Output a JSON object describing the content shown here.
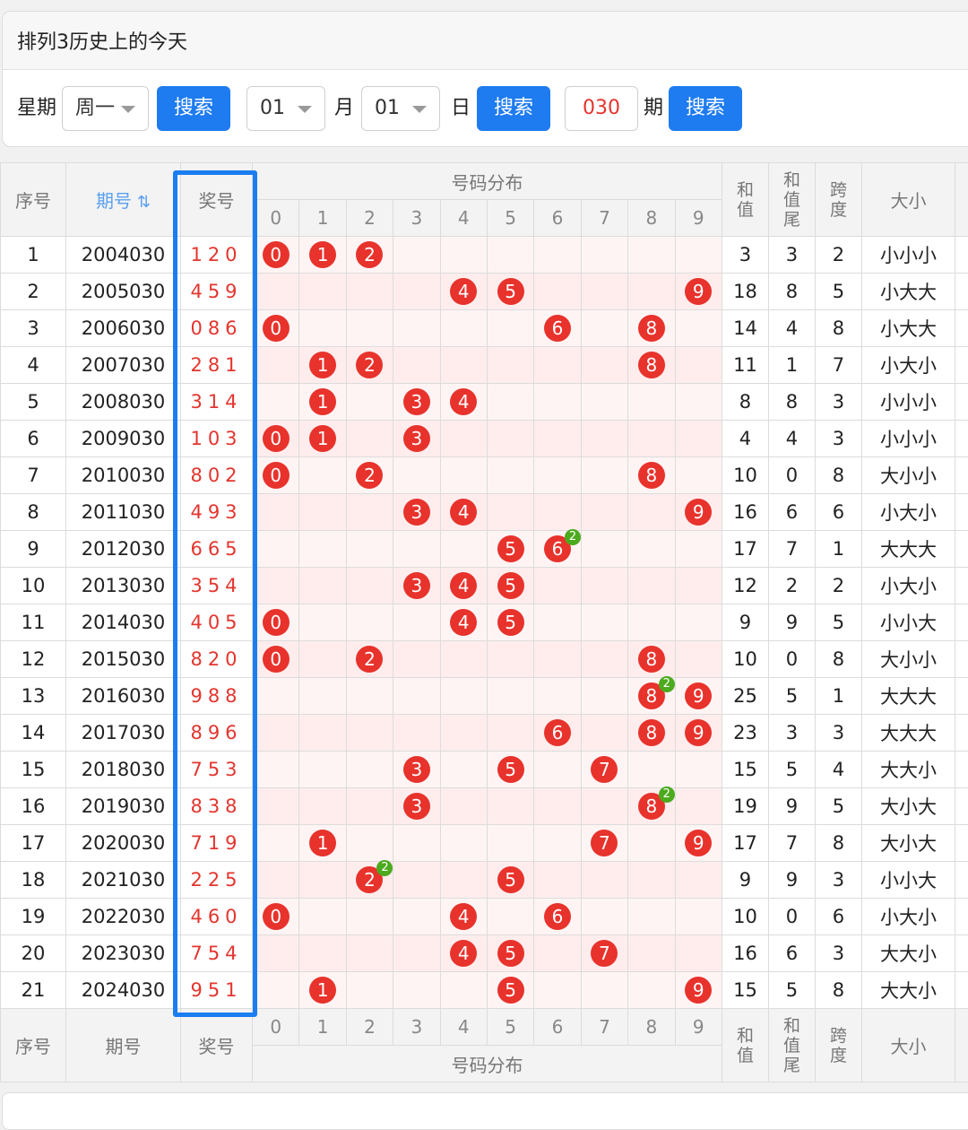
{
  "panel": {
    "title": "排列3历史上的今天"
  },
  "controls": {
    "week_label": "星期",
    "week_value": "周一",
    "search1": "搜索",
    "month_value": "01",
    "month_label": "月",
    "day_value": "01",
    "day_label": "日",
    "search2": "搜索",
    "period_value": "030",
    "period_label": "期",
    "search3": "搜索"
  },
  "table": {
    "headers": {
      "seq": "序号",
      "period": "期号",
      "prize": "奖号",
      "dist": "号码分布",
      "sum": "和值",
      "sum_tail": "和值尾",
      "span": "跨度",
      "size": "大小"
    },
    "digits": [
      "0",
      "1",
      "2",
      "3",
      "4",
      "5",
      "6",
      "7",
      "8",
      "9"
    ],
    "rows": [
      {
        "seq": "1",
        "period": "2004030",
        "prize": "120",
        "d": [
          0,
          1,
          2
        ],
        "sum": "3",
        "tail": "3",
        "span": "2",
        "size": "小小小"
      },
      {
        "seq": "2",
        "period": "2005030",
        "prize": "459",
        "d": [
          4,
          5,
          9
        ],
        "sum": "18",
        "tail": "8",
        "span": "5",
        "size": "小大大"
      },
      {
        "seq": "3",
        "period": "2006030",
        "prize": "086",
        "d": [
          0,
          6,
          8
        ],
        "sum": "14",
        "tail": "4",
        "span": "8",
        "size": "小大大"
      },
      {
        "seq": "4",
        "period": "2007030",
        "prize": "281",
        "d": [
          1,
          2,
          8
        ],
        "sum": "11",
        "tail": "1",
        "span": "7",
        "size": "小大小"
      },
      {
        "seq": "5",
        "period": "2008030",
        "prize": "314",
        "d": [
          1,
          3,
          4
        ],
        "sum": "8",
        "tail": "8",
        "span": "3",
        "size": "小小小"
      },
      {
        "seq": "6",
        "period": "2009030",
        "prize": "103",
        "d": [
          0,
          1,
          3
        ],
        "sum": "4",
        "tail": "4",
        "span": "3",
        "size": "小小小"
      },
      {
        "seq": "7",
        "period": "2010030",
        "prize": "802",
        "d": [
          0,
          2,
          8
        ],
        "sum": "10",
        "tail": "0",
        "span": "8",
        "size": "大小小"
      },
      {
        "seq": "8",
        "period": "2011030",
        "prize": "493",
        "d": [
          3,
          4,
          9
        ],
        "sum": "16",
        "tail": "6",
        "span": "6",
        "size": "小大小"
      },
      {
        "seq": "9",
        "period": "2012030",
        "prize": "665",
        "d": [
          5,
          6
        ],
        "rep": {
          "digit": 6,
          "count": "2"
        },
        "sum": "17",
        "tail": "7",
        "span": "1",
        "size": "大大大"
      },
      {
        "seq": "10",
        "period": "2013030",
        "prize": "354",
        "d": [
          3,
          4,
          5
        ],
        "sum": "12",
        "tail": "2",
        "span": "2",
        "size": "小大小"
      },
      {
        "seq": "11",
        "period": "2014030",
        "prize": "405",
        "d": [
          0,
          4,
          5
        ],
        "sum": "9",
        "tail": "9",
        "span": "5",
        "size": "小小大"
      },
      {
        "seq": "12",
        "period": "2015030",
        "prize": "820",
        "d": [
          0,
          2,
          8
        ],
        "sum": "10",
        "tail": "0",
        "span": "8",
        "size": "大小小"
      },
      {
        "seq": "13",
        "period": "2016030",
        "prize": "988",
        "d": [
          8,
          9
        ],
        "rep": {
          "digit": 8,
          "count": "2"
        },
        "sum": "25",
        "tail": "5",
        "span": "1",
        "size": "大大大"
      },
      {
        "seq": "14",
        "period": "2017030",
        "prize": "896",
        "d": [
          6,
          8,
          9
        ],
        "sum": "23",
        "tail": "3",
        "span": "3",
        "size": "大大大"
      },
      {
        "seq": "15",
        "period": "2018030",
        "prize": "753",
        "d": [
          3,
          5,
          7
        ],
        "sum": "15",
        "tail": "5",
        "span": "4",
        "size": "大大小"
      },
      {
        "seq": "16",
        "period": "2019030",
        "prize": "838",
        "d": [
          3,
          8
        ],
        "rep": {
          "digit": 8,
          "count": "2"
        },
        "sum": "19",
        "tail": "9",
        "span": "5",
        "size": "大小大"
      },
      {
        "seq": "17",
        "period": "2020030",
        "prize": "719",
        "d": [
          1,
          7,
          9
        ],
        "sum": "17",
        "tail": "7",
        "span": "8",
        "size": "大小大"
      },
      {
        "seq": "18",
        "period": "2021030",
        "prize": "225",
        "d": [
          2,
          5
        ],
        "rep": {
          "digit": 2,
          "count": "2"
        },
        "sum": "9",
        "tail": "9",
        "span": "3",
        "size": "小小大"
      },
      {
        "seq": "19",
        "period": "2022030",
        "prize": "460",
        "d": [
          0,
          4,
          6
        ],
        "sum": "10",
        "tail": "0",
        "span": "6",
        "size": "小大小"
      },
      {
        "seq": "20",
        "period": "2023030",
        "prize": "754",
        "d": [
          4,
          5,
          7
        ],
        "sum": "16",
        "tail": "6",
        "span": "3",
        "size": "大大小"
      },
      {
        "seq": "21",
        "period": "2024030",
        "prize": "951",
        "d": [
          1,
          5,
          9
        ],
        "sum": "15",
        "tail": "5",
        "span": "8",
        "size": "大大小"
      }
    ]
  },
  "colors": {
    "accent": "#1e7bf0",
    "ball": "#e8322c",
    "repeat_badge": "#4caa1e",
    "highlight": "#1a7ef0"
  }
}
